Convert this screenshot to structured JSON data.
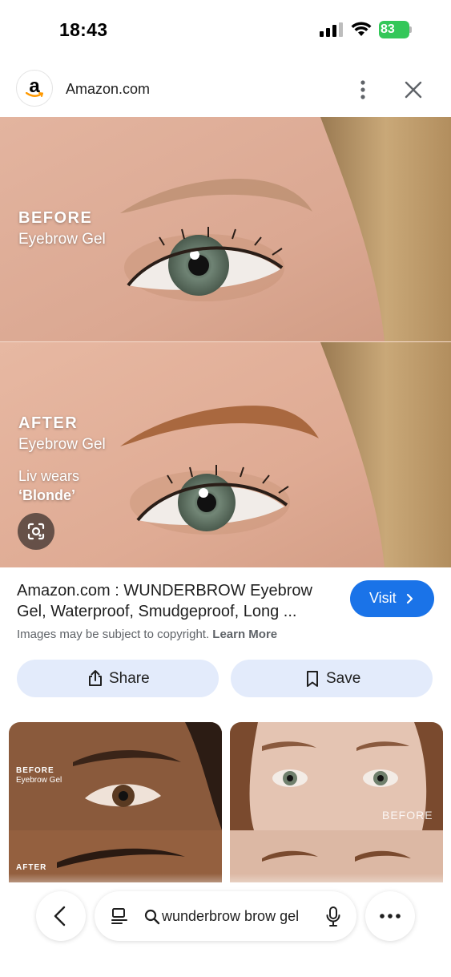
{
  "status_bar": {
    "time": "18:43",
    "battery": "83"
  },
  "header": {
    "site_name": "Amazon.com",
    "logo_letter": "a"
  },
  "main_image": {
    "before_title": "BEFORE",
    "before_sub": "Eyebrow Gel",
    "after_title": "AFTER",
    "after_sub": "Eyebrow Gel",
    "shade_line1": "Liv wears",
    "shade_line2": "‘Blonde’"
  },
  "result": {
    "title": "Amazon.com : WUNDERBROW Eyebrow Gel, Waterproof, Smudgeproof, Long ...",
    "visit_label": "Visit",
    "copyright": "Images may be subject to copyright.",
    "learn_more": "Learn More",
    "share_label": "Share",
    "save_label": "Save"
  },
  "related": [
    {
      "label_top": "BEFORE",
      "label_sub": "Eyebrow Gel",
      "label_bottom": "AFTER"
    },
    {
      "watermark": "BEFORE"
    }
  ],
  "search": {
    "query": "wunderbrow brow gel"
  },
  "colors": {
    "accent": "#1a73e8",
    "chip_bg": "#e3ebfb",
    "battery": "#34c759"
  },
  "icons": [
    "signal-icon",
    "wifi-icon",
    "amazon-logo",
    "more-vert-icon",
    "close-icon",
    "lens-icon",
    "chevron-right-icon",
    "share-icon",
    "bookmark-icon",
    "back-arrow-icon",
    "tabs-icon",
    "search-icon",
    "mic-icon",
    "more-horiz-icon"
  ]
}
